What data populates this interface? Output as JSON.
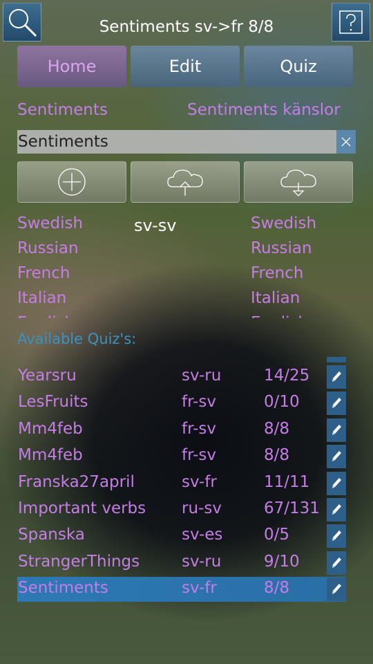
{
  "header": {
    "title": "Sentiments sv->fr 8/8",
    "search_icon": "search-icon",
    "help_icon": "help-icon"
  },
  "tabs": [
    {
      "label": "Home",
      "active": true
    },
    {
      "label": "Edit",
      "active": false
    },
    {
      "label": "Quiz",
      "active": false
    }
  ],
  "quiz_info": {
    "name": "Sentiments",
    "description": "Sentiments känslor"
  },
  "search": {
    "value": "Sentiments"
  },
  "actions": [
    "add-icon",
    "upload-cloud-icon",
    "download-cloud-icon"
  ],
  "languages": {
    "pair": "sv-sv",
    "left": [
      "Swedish",
      "Russian",
      "French",
      "Italian",
      "English"
    ],
    "right": [
      "Swedish",
      "Russian",
      "French",
      "Italian",
      "English"
    ],
    "left_selected": "Swedish",
    "right_selected": "Swedish"
  },
  "available_label": "Available Quiz's:",
  "quizzes": [
    {
      "name": "Yearsru",
      "pair": "sv-ru",
      "score": "14/25"
    },
    {
      "name": "LesFruits",
      "pair": "fr-sv",
      "score": "0/10"
    },
    {
      "name": "Mm4feb",
      "pair": "fr-sv",
      "score": "8/8"
    },
    {
      "name": "Mm4feb",
      "pair": "fr-sv",
      "score": "8/8"
    },
    {
      "name": "Franska27april",
      "pair": "sv-fr",
      "score": "11/11"
    },
    {
      "name": "Important verbs",
      "pair": "ru-sv",
      "score": "67/131"
    },
    {
      "name": "Spanska",
      "pair": "sv-es",
      "score": "0/5"
    },
    {
      "name": "StrangerThings",
      "pair": "sv-ru",
      "score": "9/10"
    },
    {
      "name": "Sentiments",
      "pair": "sv-fr",
      "score": "8/8",
      "selected": true
    }
  ],
  "colors": {
    "accent_purple": "#c67de6",
    "selection_blue": "#2c73b0",
    "header_blue": "#23496a"
  }
}
